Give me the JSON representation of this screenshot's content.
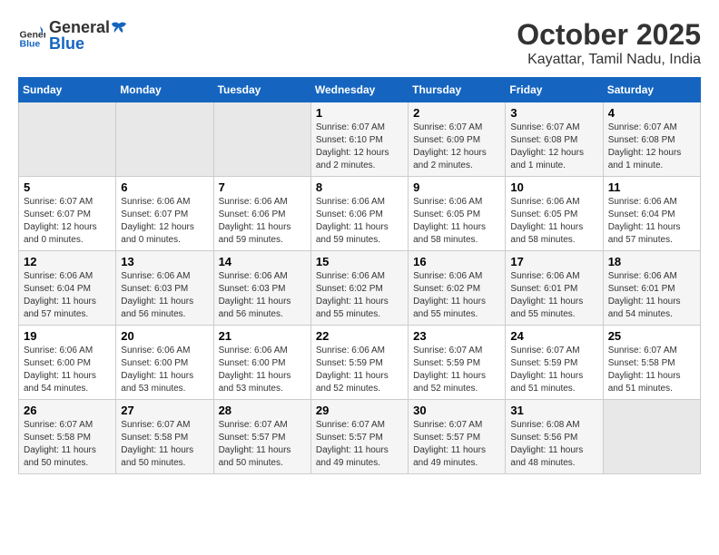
{
  "header": {
    "logo_general": "General",
    "logo_blue": "Blue",
    "month": "October 2025",
    "location": "Kayattar, Tamil Nadu, India"
  },
  "days_of_week": [
    "Sunday",
    "Monday",
    "Tuesday",
    "Wednesday",
    "Thursday",
    "Friday",
    "Saturday"
  ],
  "weeks": [
    [
      {
        "day": "",
        "info": ""
      },
      {
        "day": "",
        "info": ""
      },
      {
        "day": "",
        "info": ""
      },
      {
        "day": "1",
        "info": "Sunrise: 6:07 AM\nSunset: 6:10 PM\nDaylight: 12 hours and 2 minutes."
      },
      {
        "day": "2",
        "info": "Sunrise: 6:07 AM\nSunset: 6:09 PM\nDaylight: 12 hours and 2 minutes."
      },
      {
        "day": "3",
        "info": "Sunrise: 6:07 AM\nSunset: 6:08 PM\nDaylight: 12 hours and 1 minute."
      },
      {
        "day": "4",
        "info": "Sunrise: 6:07 AM\nSunset: 6:08 PM\nDaylight: 12 hours and 1 minute."
      }
    ],
    [
      {
        "day": "5",
        "info": "Sunrise: 6:07 AM\nSunset: 6:07 PM\nDaylight: 12 hours and 0 minutes."
      },
      {
        "day": "6",
        "info": "Sunrise: 6:06 AM\nSunset: 6:07 PM\nDaylight: 12 hours and 0 minutes."
      },
      {
        "day": "7",
        "info": "Sunrise: 6:06 AM\nSunset: 6:06 PM\nDaylight: 11 hours and 59 minutes."
      },
      {
        "day": "8",
        "info": "Sunrise: 6:06 AM\nSunset: 6:06 PM\nDaylight: 11 hours and 59 minutes."
      },
      {
        "day": "9",
        "info": "Sunrise: 6:06 AM\nSunset: 6:05 PM\nDaylight: 11 hours and 58 minutes."
      },
      {
        "day": "10",
        "info": "Sunrise: 6:06 AM\nSunset: 6:05 PM\nDaylight: 11 hours and 58 minutes."
      },
      {
        "day": "11",
        "info": "Sunrise: 6:06 AM\nSunset: 6:04 PM\nDaylight: 11 hours and 57 minutes."
      }
    ],
    [
      {
        "day": "12",
        "info": "Sunrise: 6:06 AM\nSunset: 6:04 PM\nDaylight: 11 hours and 57 minutes."
      },
      {
        "day": "13",
        "info": "Sunrise: 6:06 AM\nSunset: 6:03 PM\nDaylight: 11 hours and 56 minutes."
      },
      {
        "day": "14",
        "info": "Sunrise: 6:06 AM\nSunset: 6:03 PM\nDaylight: 11 hours and 56 minutes."
      },
      {
        "day": "15",
        "info": "Sunrise: 6:06 AM\nSunset: 6:02 PM\nDaylight: 11 hours and 55 minutes."
      },
      {
        "day": "16",
        "info": "Sunrise: 6:06 AM\nSunset: 6:02 PM\nDaylight: 11 hours and 55 minutes."
      },
      {
        "day": "17",
        "info": "Sunrise: 6:06 AM\nSunset: 6:01 PM\nDaylight: 11 hours and 55 minutes."
      },
      {
        "day": "18",
        "info": "Sunrise: 6:06 AM\nSunset: 6:01 PM\nDaylight: 11 hours and 54 minutes."
      }
    ],
    [
      {
        "day": "19",
        "info": "Sunrise: 6:06 AM\nSunset: 6:00 PM\nDaylight: 11 hours and 54 minutes."
      },
      {
        "day": "20",
        "info": "Sunrise: 6:06 AM\nSunset: 6:00 PM\nDaylight: 11 hours and 53 minutes."
      },
      {
        "day": "21",
        "info": "Sunrise: 6:06 AM\nSunset: 6:00 PM\nDaylight: 11 hours and 53 minutes."
      },
      {
        "day": "22",
        "info": "Sunrise: 6:06 AM\nSunset: 5:59 PM\nDaylight: 11 hours and 52 minutes."
      },
      {
        "day": "23",
        "info": "Sunrise: 6:07 AM\nSunset: 5:59 PM\nDaylight: 11 hours and 52 minutes."
      },
      {
        "day": "24",
        "info": "Sunrise: 6:07 AM\nSunset: 5:59 PM\nDaylight: 11 hours and 51 minutes."
      },
      {
        "day": "25",
        "info": "Sunrise: 6:07 AM\nSunset: 5:58 PM\nDaylight: 11 hours and 51 minutes."
      }
    ],
    [
      {
        "day": "26",
        "info": "Sunrise: 6:07 AM\nSunset: 5:58 PM\nDaylight: 11 hours and 50 minutes."
      },
      {
        "day": "27",
        "info": "Sunrise: 6:07 AM\nSunset: 5:58 PM\nDaylight: 11 hours and 50 minutes."
      },
      {
        "day": "28",
        "info": "Sunrise: 6:07 AM\nSunset: 5:57 PM\nDaylight: 11 hours and 50 minutes."
      },
      {
        "day": "29",
        "info": "Sunrise: 6:07 AM\nSunset: 5:57 PM\nDaylight: 11 hours and 49 minutes."
      },
      {
        "day": "30",
        "info": "Sunrise: 6:07 AM\nSunset: 5:57 PM\nDaylight: 11 hours and 49 minutes."
      },
      {
        "day": "31",
        "info": "Sunrise: 6:08 AM\nSunset: 5:56 PM\nDaylight: 11 hours and 48 minutes."
      },
      {
        "day": "",
        "info": ""
      }
    ]
  ]
}
